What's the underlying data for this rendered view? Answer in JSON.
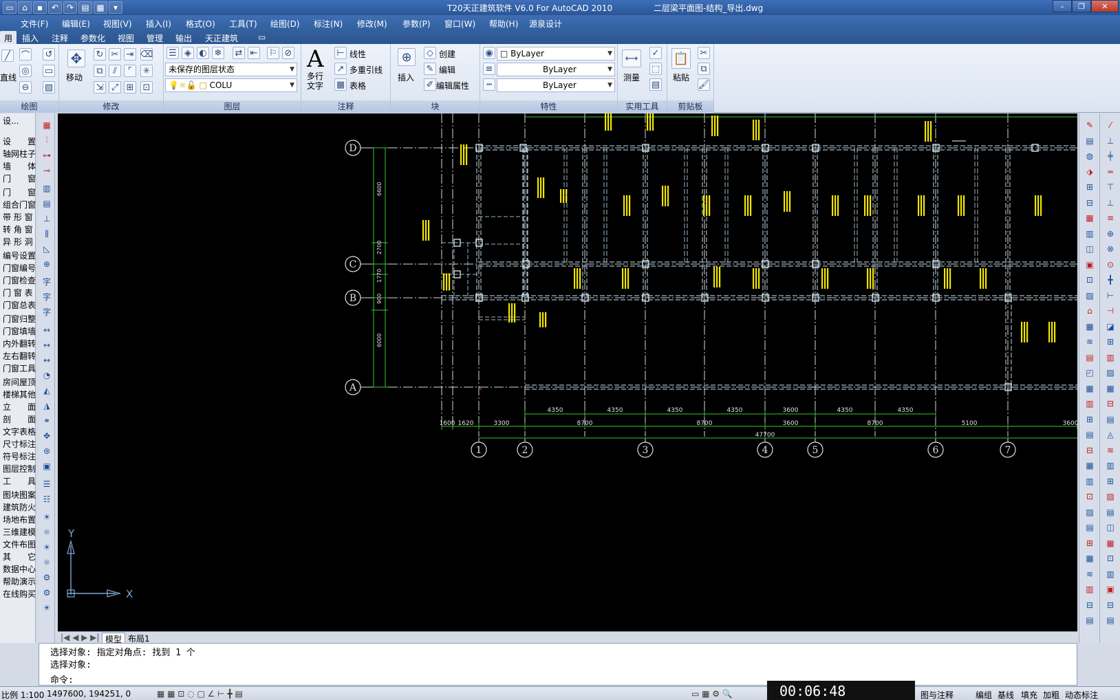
{
  "titlebar": {
    "app_title": "T20天正建筑软件 V6.0 For AutoCAD 2010",
    "file_title": "二层梁平面图-结构_导出.dwg",
    "minimize": "–",
    "restore": "❐",
    "close": "✕"
  },
  "menubar": {
    "items": [
      "文件(F)",
      "编辑(E)",
      "视图(V)",
      "插入(I)",
      "格式(O)",
      "工具(T)",
      "绘图(D)",
      "标注(N)",
      "修改(M)",
      "参数(P)",
      "窗口(W)",
      "帮助(H)",
      "源泉设计"
    ]
  },
  "ribbon_tabs": {
    "items": [
      "用",
      "插入",
      "注释",
      "参数化",
      "视图",
      "管理",
      "输出",
      "天正建筑"
    ]
  },
  "ribbon": {
    "draw_panel": "绘图",
    "draw_line": "直线",
    "modify_panel": "修改",
    "move": "移动",
    "layer_panel": "图层",
    "layer_state": "未保存的图层状态",
    "current_layer": "COLU",
    "annotate_panel": "注释",
    "multiline_text": "多行文字",
    "linear": "线性",
    "multileader": "多重引线",
    "table": "表格",
    "block_panel": "块",
    "insert": "插入",
    "create": "创建",
    "edit": "编辑",
    "edit_attr": "编辑属性",
    "properties_panel": "特性",
    "color": "ByLayer",
    "linetype": "ByLayer",
    "lineweight": "ByLayer",
    "utilities_panel": "实用工具",
    "measure": "测量",
    "clipboard_panel": "剪贴板",
    "paste": "粘贴"
  },
  "left_palette": {
    "header": "设...",
    "items": [
      "设　　置",
      "轴网柱子",
      "墙　　体",
      "门　　窗",
      "门　　窗",
      "组合门窗",
      "带 形 窗",
      "转 角 窗",
      "异 形 洞",
      "编号设置",
      "门窗编号",
      "门窗检查",
      "门 窗 表",
      "门窗总表",
      "门窗归整",
      "门窗填墙",
      "内外翻转",
      "左右翻转",
      "门窗工具",
      "房间屋顶",
      "楼梯其他",
      "立　　面",
      "剖　　面",
      "文字表格",
      "尺寸标注",
      "符号标注",
      "图层控制",
      "工　　具",
      "图块图案",
      "建筑防火",
      "场地布置",
      "三维建模",
      "文件布图",
      "其　　它",
      "数据中心",
      "帮助演示",
      "在线购买"
    ]
  },
  "drawing": {
    "axis_letters": [
      "D",
      "C",
      "B",
      "A"
    ],
    "axis_numbers": [
      "1",
      "2",
      "3",
      "4",
      "5",
      "6",
      "7"
    ],
    "dim_row1": [
      "4350",
      "4350",
      "4350",
      "4350",
      "3600",
      "4350",
      "4350"
    ],
    "dim_row2": [
      "1600",
      "1620",
      "3300",
      "8700",
      "8700",
      "3600",
      "8700",
      "5100",
      "3600"
    ],
    "total": "47700",
    "left_dims": [
      "6600",
      "2700",
      "1770",
      "900",
      "6000"
    ],
    "ucs_x": "X",
    "ucs_y": "Y"
  },
  "layout_tabs": {
    "model": "模型",
    "layout1": "布局1"
  },
  "command": {
    "line1": "选择对象: 指定对角点: 找到 1 个",
    "line2": "选择对象:",
    "prompt": "命令:"
  },
  "statusbar": {
    "scale": "比例 1:100",
    "coords": "1497600,  194251,  0",
    "annotate": "图与注释",
    "items": [
      "编组",
      "基线",
      "填充",
      "加粗",
      "动态标注"
    ]
  },
  "timer": "00:06:48"
}
